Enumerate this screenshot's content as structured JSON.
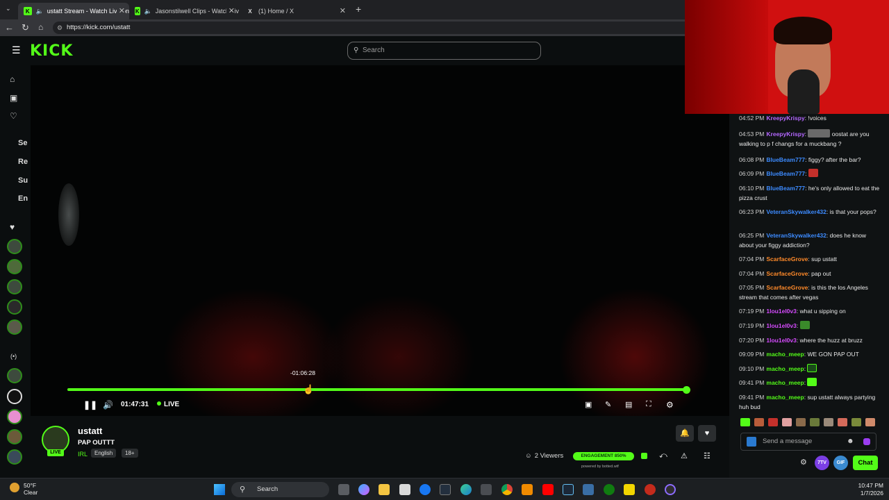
{
  "browser": {
    "tabs": [
      {
        "label": "ustatt Stream - Watch Live on",
        "active": true
      },
      {
        "label": "Jasonstilwell Clips - Watch Liv",
        "active": false
      },
      {
        "label": "(1) Home / X",
        "active": false
      }
    ],
    "url": "https://kick.com/ustatt"
  },
  "header": {
    "logo": "KICK",
    "search_placeholder": "Search"
  },
  "sidebar": {
    "collapsed_labels": [
      "Se",
      "Re",
      "Su",
      "En"
    ]
  },
  "player": {
    "seek_tooltip": "-01:06:28",
    "elapsed": "01:47:31",
    "live_label": "LIVE",
    "progress_fraction": 0.38
  },
  "channel": {
    "name": "ustatt",
    "title": "PAP OUTTT",
    "category": "IRL",
    "tags": [
      "English",
      "18+"
    ],
    "avatar_badge": "LIVE",
    "viewers": "2 Viewers",
    "engagement_badge": "ENGAGEMENT 850%",
    "powered_by": "powered by botted.wtf"
  },
  "chat": {
    "messages": [
      {
        "time": "04:52 PM",
        "user": "KreepyKrispy",
        "color": "#b467ff",
        "text": "!voices"
      },
      {
        "time": "04:53 PM",
        "user": "KreepyKrispy",
        "color": "#b467ff",
        "text": "oostat are you walking to p f changs for a muckbang ?"
      },
      {
        "time": "06:08 PM",
        "user": "BlueBeam777",
        "color": "#3d8bff",
        "text": "figgy? after the bar?"
      },
      {
        "time": "06:09 PM",
        "user": "BlueBeam777",
        "color": "#3d8bff",
        "text": ""
      },
      {
        "time": "06:10 PM",
        "user": "BlueBeam777",
        "color": "#3d8bff",
        "text": "he's only allowed to eat the pizza crust"
      },
      {
        "time": "06:23 PM",
        "user": "VeteranSkywalker432",
        "color": "#3d8bff",
        "text": "is that your pops?"
      },
      {
        "time": "06:25 PM",
        "user": "VeteranSkywalker432",
        "color": "#3d8bff",
        "text": "does he know about your figgy addiction?"
      },
      {
        "time": "07:04 PM",
        "user": "ScarfaceGrove",
        "color": "#ff8a2a",
        "text": "sup ustatt"
      },
      {
        "time": "07:04 PM",
        "user": "ScarfaceGrove",
        "color": "#ff8a2a",
        "text": "pap out"
      },
      {
        "time": "07:05 PM",
        "user": "ScarfaceGrove",
        "color": "#ff8a2a",
        "text": "is this the los Angeles stream that comes after vegas"
      },
      {
        "time": "07:19 PM",
        "user": "1lou1el0v3",
        "color": "#d64bff",
        "text": "what u sipping on"
      },
      {
        "time": "07:19 PM",
        "user": "1lou1el0v3",
        "color": "#d64bff",
        "text": ""
      },
      {
        "time": "07:20 PM",
        "user": "1lou1el0v3",
        "color": "#d64bff",
        "text": "where the huzz at bruzz"
      },
      {
        "time": "09:09 PM",
        "user": "macho_meep",
        "color": "#53fc18",
        "text": "WE GON PAP OUT"
      },
      {
        "time": "09:10 PM",
        "user": "macho_meep",
        "color": "#53fc18",
        "text": ""
      },
      {
        "time": "09:41 PM",
        "user": "macho_meep",
        "color": "#53fc18",
        "text": ""
      },
      {
        "time": "09:41 PM",
        "user": "macho_meep",
        "color": "#53fc18",
        "text": "sup ustatt always partying huh bud"
      }
    ],
    "input_placeholder": "Send a message",
    "send_label": "Chat",
    "round_buttons": [
      "7TV",
      "GIF",
      ""
    ]
  },
  "taskbar": {
    "temperature": "50°F",
    "condition": "Clear",
    "search_label": "Search",
    "time": "10:47 PM",
    "date": "1/7/2026"
  },
  "colors": {
    "accent": "#53fc18",
    "background": "#0b0e0f"
  }
}
